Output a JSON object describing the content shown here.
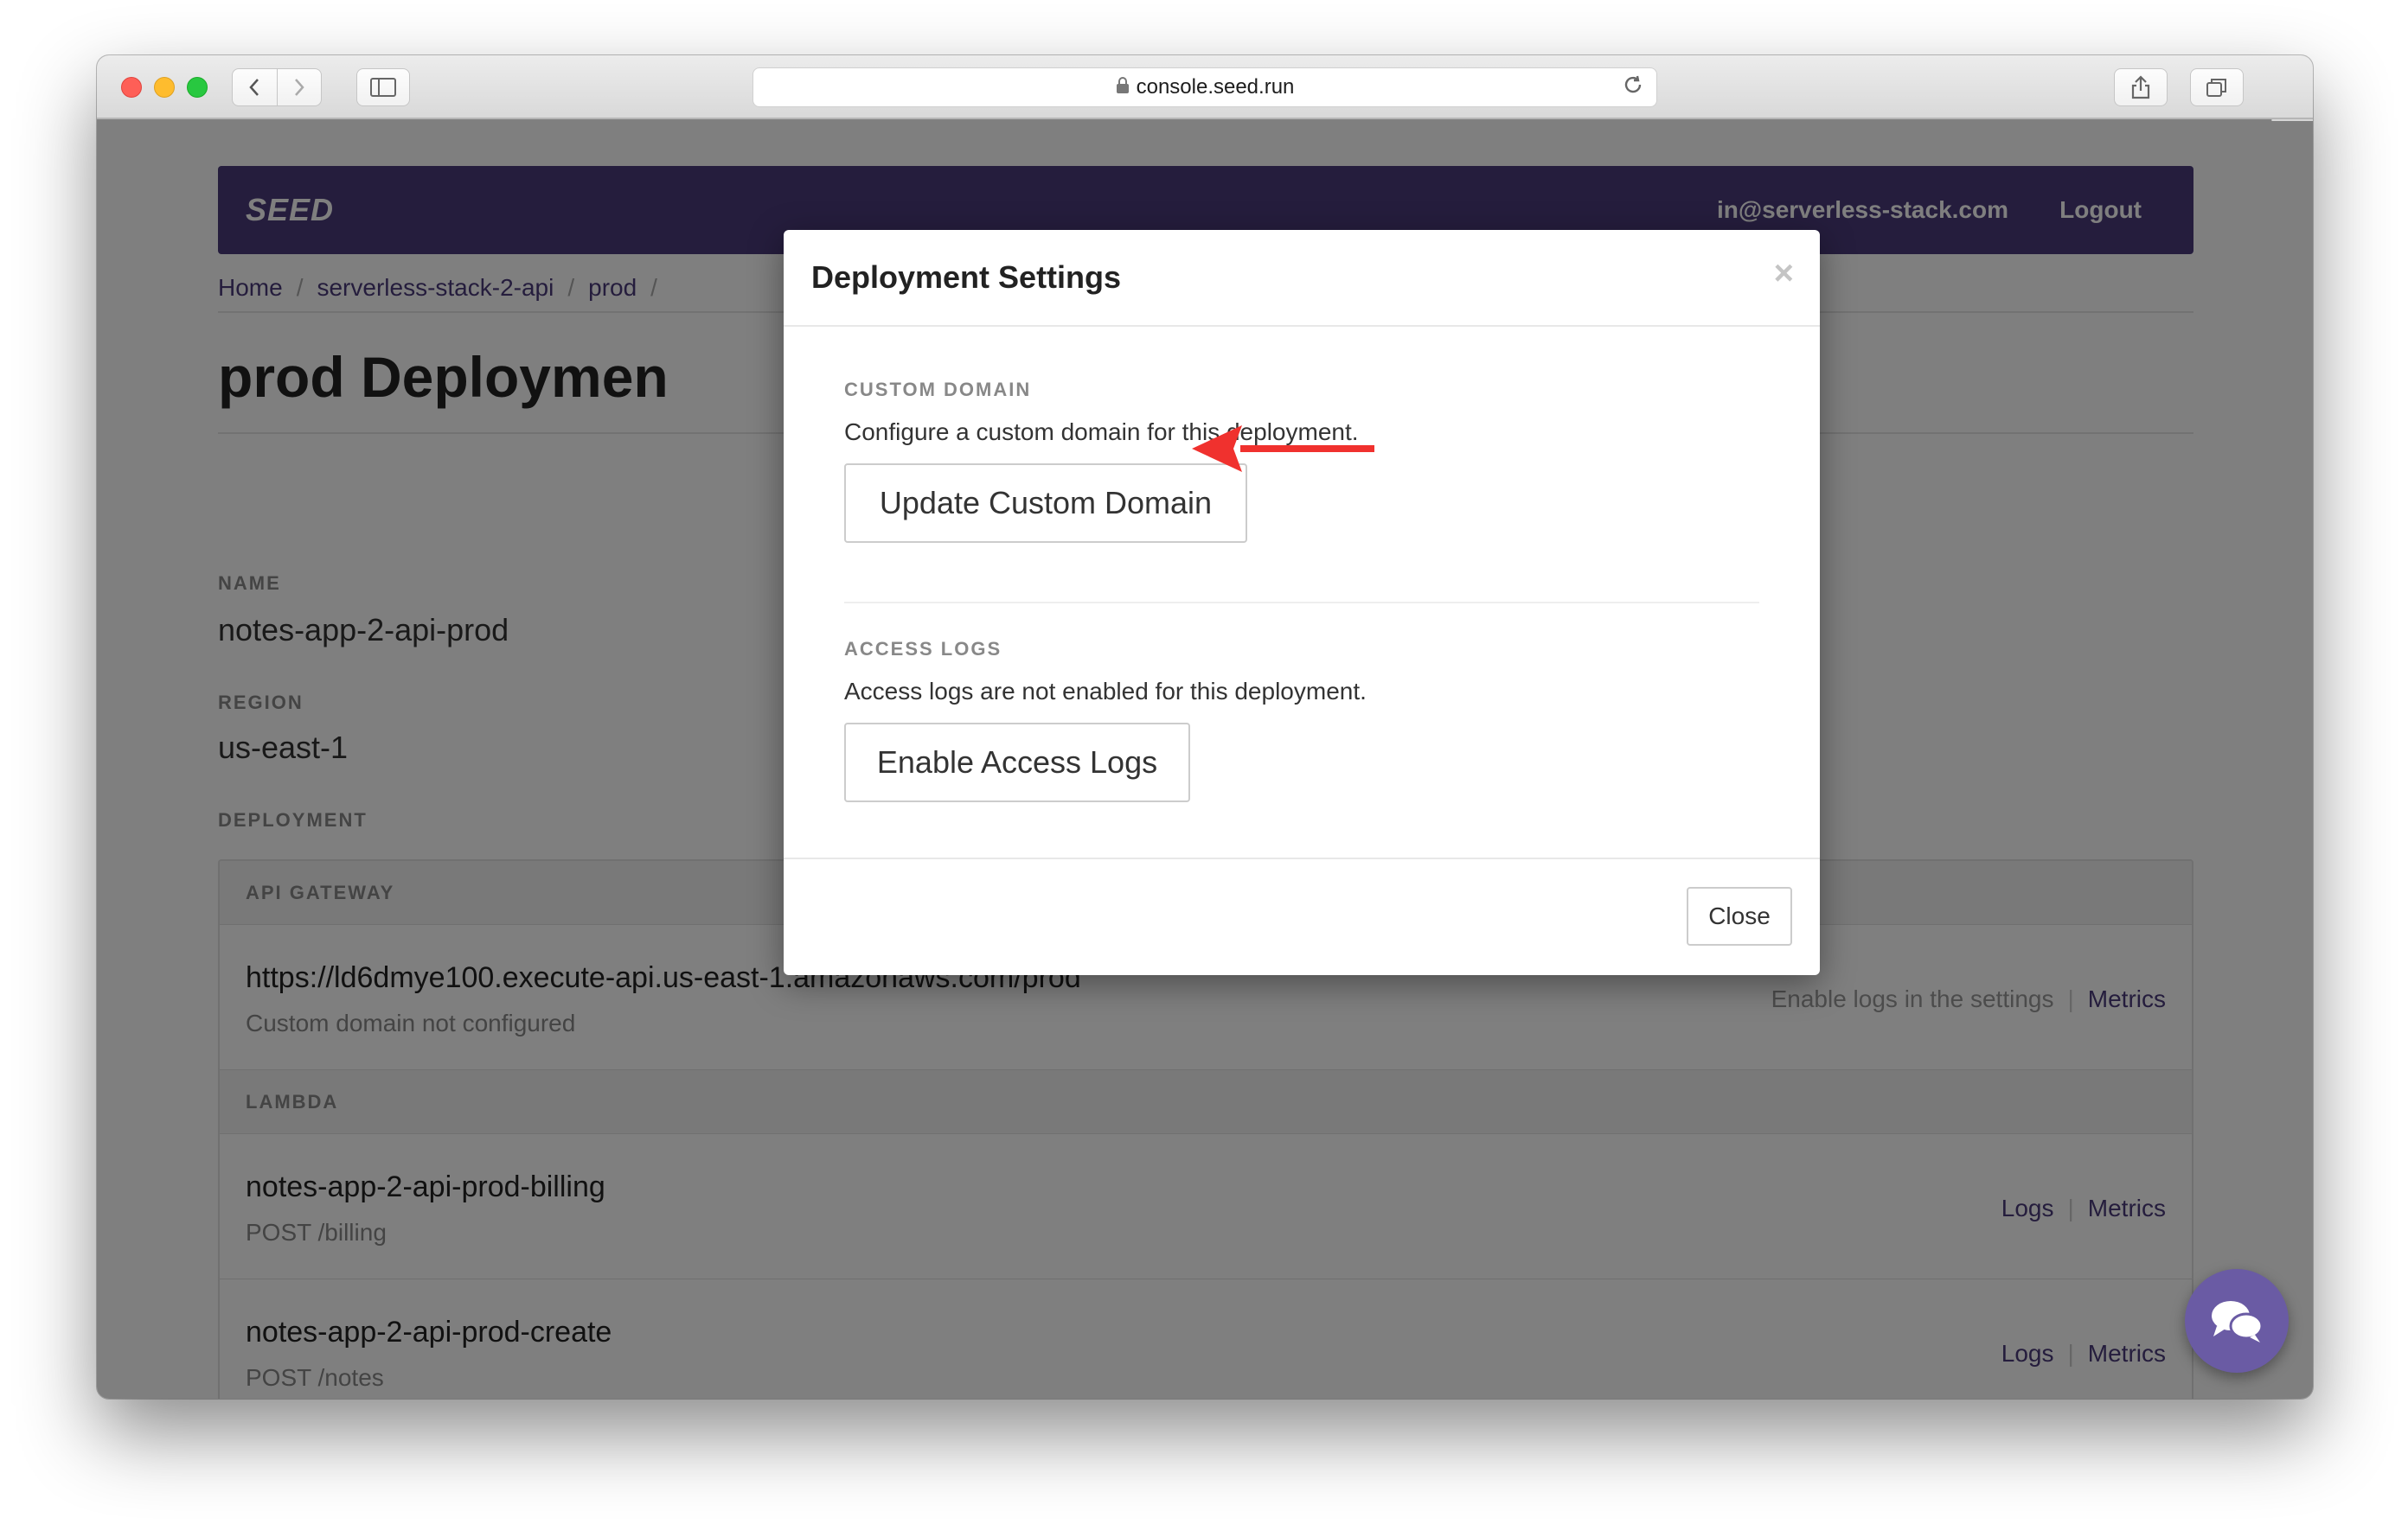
{
  "browser": {
    "url": "console.seed.run"
  },
  "navbar": {
    "logo": "SEED",
    "email": "in@serverless-stack.com",
    "logout": "Logout"
  },
  "breadcrumb": [
    "Home",
    "serverless-stack-2-api",
    "prod"
  ],
  "page": {
    "title": "prod Deploymen",
    "name_label": "NAME",
    "name_value": "notes-app-2-api-prod",
    "region_label": "REGION",
    "region_value": "us-east-1",
    "deployment_label": "DEPLOYMENT"
  },
  "api_gateway": {
    "header": "API GATEWAY",
    "url": "https://ld6dmye100.execute-api.us-east-1.amazonaws.com/prod",
    "sub": "Custom domain not configured",
    "logs_hint": "Enable logs in the settings",
    "metrics": "Metrics"
  },
  "lambda": {
    "header": "LAMBDA",
    "items": [
      {
        "name": "notes-app-2-api-prod-billing",
        "route": "POST /billing",
        "logs": "Logs",
        "metrics": "Metrics"
      },
      {
        "name": "notes-app-2-api-prod-create",
        "route": "POST /notes",
        "logs": "Logs",
        "metrics": "Metrics"
      }
    ]
  },
  "modal": {
    "title": "Deployment Settings",
    "close_x": "×",
    "custom_domain_label": "CUSTOM DOMAIN",
    "custom_domain_text": "Configure a custom domain for this deployment.",
    "custom_domain_button": "Update Custom Domain",
    "access_logs_label": "ACCESS LOGS",
    "access_logs_text": "Access logs are not enabled for this deployment.",
    "access_logs_button": "Enable Access Logs",
    "close_button": "Close"
  },
  "colors": {
    "brand": "#4b3b7a",
    "arrow": "#f0312e",
    "chat": "#6a5ba4"
  },
  "icons": [
    "lock-icon",
    "reload-icon",
    "back-icon",
    "forward-icon",
    "sidebar-icon",
    "share-icon",
    "tabs-icon",
    "chat-icon",
    "arrow-icon"
  ]
}
